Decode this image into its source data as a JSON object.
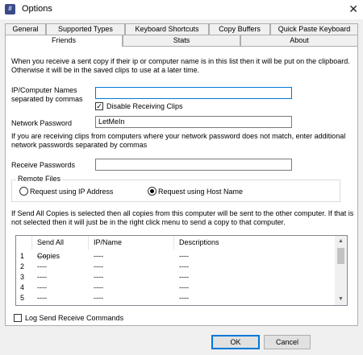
{
  "window": {
    "title": "Options",
    "icon": "app-icon",
    "close_glyph": "✕"
  },
  "tabs_row1": [
    {
      "label": "General"
    },
    {
      "label": "Supported Types"
    },
    {
      "label": "Keyboard Shortcuts"
    },
    {
      "label": "Copy Buffers"
    },
    {
      "label": "Quick Paste Keyboard"
    }
  ],
  "tabs_row2": [
    {
      "label": "Friends",
      "active": true
    },
    {
      "label": "Stats"
    },
    {
      "label": "About"
    }
  ],
  "friends": {
    "intro": "When you receive a sent copy if their ip or computer name is in this list then it will be put on the clipboard. Otherwise it will be in the saved clips to use at a later time.",
    "ip_label": "IP/Computer Names separated by commas",
    "ip_value": "",
    "disable_receiving_label": "Disable Receiving Clips",
    "disable_receiving_checked": true,
    "network_password_label": "Network Password",
    "network_password_value": "LetMeIn",
    "receive_info": "If you are receiving clips from computers where your network password does not match, enter additional network passwords separated by commas",
    "receive_passwords_label": "Receive Passwords",
    "receive_passwords_value": "",
    "remote_files": {
      "label": "Remote Files",
      "option_ip": "Request using IP Address",
      "option_host": "Request using Host Name",
      "selected": "host"
    },
    "send_all_info": "If Send All Copies is selected then all copies from this computer will be sent to the other computer.  If that is not selected then it will just be in the right click menu to send a copy to that computer.",
    "table": {
      "columns": [
        "",
        "Send All Copies",
        "IP/Name",
        "Descriptions"
      ],
      "rows": [
        [
          "1",
          "----",
          "----",
          "----"
        ],
        [
          "2",
          "----",
          "----",
          "----"
        ],
        [
          "3",
          "----",
          "----",
          "----"
        ],
        [
          "4",
          "----",
          "----",
          "----"
        ],
        [
          "5",
          "----",
          "----",
          "----"
        ]
      ]
    },
    "log_label": "Log Send Receive Commands",
    "log_checked": false
  },
  "buttons": {
    "ok": "OK",
    "cancel": "Cancel"
  },
  "colors": {
    "focus_border": "#0078d7",
    "panel_bg": "#ffffff",
    "window_bg": "#f0f0f0"
  }
}
